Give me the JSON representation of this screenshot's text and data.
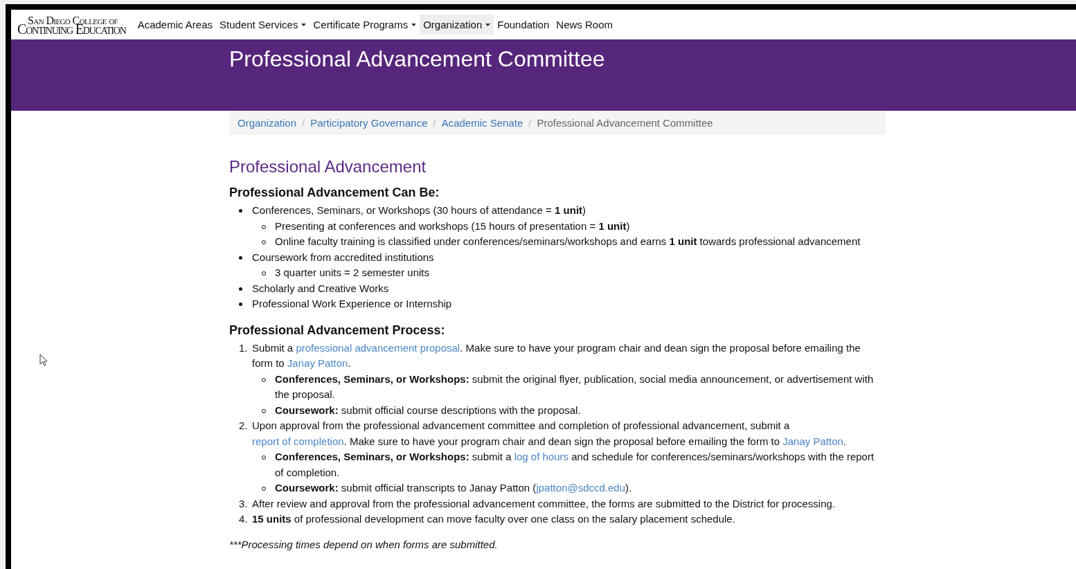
{
  "logo": {
    "line_1": "San Diego College of",
    "line_2": "Continuing Education"
  },
  "nav": [
    {
      "label": "Academic Areas",
      "dropdown": false,
      "selected": false
    },
    {
      "label": "Student Services",
      "dropdown": true,
      "selected": false
    },
    {
      "label": "Certificate Programs",
      "dropdown": true,
      "selected": false
    },
    {
      "label": "Organization",
      "dropdown": true,
      "selected": true
    },
    {
      "label": "Foundation",
      "dropdown": false,
      "selected": false
    },
    {
      "label": "News Room",
      "dropdown": false,
      "selected": false
    }
  ],
  "banner": {
    "title": "Professional Advancement Committee"
  },
  "breadcrumb": [
    {
      "label": "Organization",
      "current": false
    },
    {
      "separator": "/",
      "label": "Participatory Governance",
      "current": false
    },
    {
      "separator": "/",
      "label": "Academic Senate",
      "current": false
    },
    {
      "separator": "/",
      "label": "Professional Advancement Committee",
      "current": true
    }
  ],
  "heading": "Professional Advancement",
  "sections": [
    {
      "title": "Professional Advancement Can Be:",
      "ordered": false,
      "items": [
        {
          "segments": [
            {
              "kind": "text",
              "text": "Conferences, Seminars, or Workshops (30 hours of attendance = **1 unit**)"
            }
          ],
          "children": [
            {
              "segments": [
                {
                  "kind": "text",
                  "text": "Presenting at conferences and workshops (15 hours of presentation = **1 unit**)"
                }
              ]
            },
            {
              "segments": [
                {
                  "kind": "text",
                  "text": "Online faculty training is classified under conferences/seminars/workshops and earns **1 unit** towards professional advancement"
                }
              ]
            }
          ]
        },
        {
          "segments": [
            {
              "kind": "text",
              "text": "Coursework from accredited institutions"
            }
          ],
          "children": [
            {
              "segments": [
                {
                  "kind": "text",
                  "text": "3 quarter units = 2 semester units"
                }
              ]
            }
          ]
        },
        {
          "segments": [
            {
              "kind": "text",
              "text": "Scholarly and Creative Works"
            }
          ]
        },
        {
          "segments": [
            {
              "kind": "text",
              "text": "Professional Work Experience or Internship"
            }
          ]
        }
      ]
    },
    {
      "title": "Professional Advancement Process:",
      "ordered": true,
      "items": [
        {
          "number": "1.",
          "segments": [
            {
              "kind": "text",
              "text": "Submit a "
            },
            {
              "kind": "link",
              "text": "professional advancement proposal"
            },
            {
              "kind": "text",
              "text": ". Make sure to have your program chair and dean sign the proposal before emailing the form to "
            },
            {
              "kind": "link",
              "text": "Janay Patton"
            },
            {
              "kind": "text",
              "text": "."
            }
          ],
          "children": [
            {
              "segments": [
                {
                  "kind": "text",
                  "text": "**Conferences, Seminars, or Workshops:** submit the original flyer, publication, social media announcement, or advertisement with the proposal."
                }
              ]
            },
            {
              "segments": [
                {
                  "kind": "text",
                  "text": "**Coursework:** submit official course descriptions with the proposal."
                }
              ]
            }
          ]
        },
        {
          "number": "2.",
          "segments": [
            {
              "kind": "text",
              "text": "Upon approval from the professional advancement committee and completion of professional advancement, submit a "
            },
            {
              "kind": "link",
              "text": "report of completion"
            },
            {
              "kind": "text",
              "text": ". Make sure to have your program chair and dean sign the proposal before emailing the form to "
            },
            {
              "kind": "link",
              "text": "Janay Patton"
            },
            {
              "kind": "text",
              "text": "."
            }
          ],
          "children": [
            {
              "segments": [
                {
                  "kind": "text",
                  "text": "**Conferences, Seminars, or Workshops:** submit a "
                },
                {
                  "kind": "link",
                  "text": "log of hours"
                },
                {
                  "kind": "text",
                  "text": " and schedule for conferences/seminars/workshops with the report of completion."
                }
              ]
            },
            {
              "segments": [
                {
                  "kind": "text",
                  "text": "**Coursework:** submit official transcripts to Janay Patton ("
                },
                {
                  "kind": "link",
                  "text": "jpatton@sdccd.edu"
                },
                {
                  "kind": "text",
                  "text": ")."
                }
              ]
            }
          ]
        },
        {
          "number": "3.",
          "segments": [
            {
              "kind": "text",
              "text": "After review and approval from the professional advancement committee, the forms are submitted to the District for processing."
            }
          ]
        },
        {
          "number": "4.",
          "segments": [
            {
              "kind": "text",
              "text": "**15 units** of professional development can move faculty over one class on the salary placement schedule."
            }
          ]
        }
      ]
    }
  ],
  "note": "***Processing times depend on when forms are submitted."
}
